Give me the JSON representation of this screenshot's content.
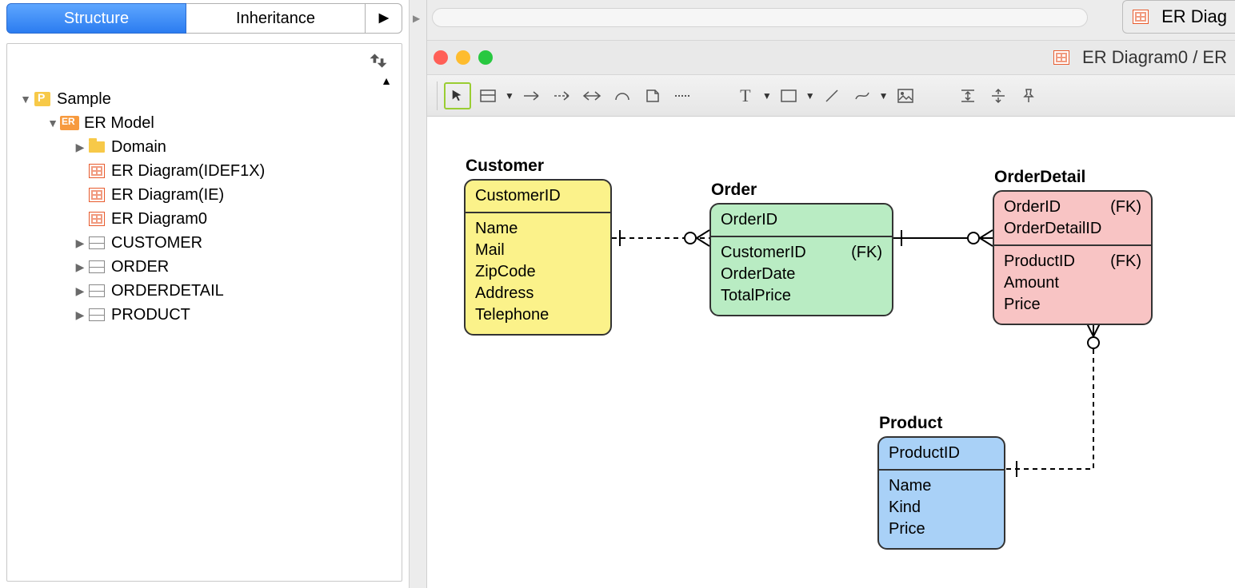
{
  "sidebar": {
    "tabs": {
      "structure": "Structure",
      "inheritance": "Inheritance"
    },
    "tree": {
      "root": "Sample",
      "ermodel": "ER Model",
      "domain": "Domain",
      "diag_idef1x": "ER Diagram(IDEF1X)",
      "diag_ie": "ER Diagram(IE)",
      "diag0": "ER Diagram0",
      "t_customer": "CUSTOMER",
      "t_order": "ORDER",
      "t_orderdetail": "ORDERDETAIL",
      "t_product": "PRODUCT"
    }
  },
  "docTab": "ER Diag",
  "winTitle": "ER Diagram0 / ER",
  "fk_label": "(FK)",
  "entities": {
    "customer": {
      "title": "Customer",
      "pk": [
        "CustomerID"
      ],
      "attrs": [
        "Name",
        "Mail",
        "ZipCode",
        "Address",
        "Telephone"
      ]
    },
    "order": {
      "title": "Order",
      "pk": [
        "OrderID"
      ],
      "attrs": [
        {
          "name": "CustomerID",
          "fk": true
        },
        {
          "name": "OrderDate"
        },
        {
          "name": "TotalPrice"
        }
      ]
    },
    "orderdetail": {
      "title": "OrderDetail",
      "pk": [
        {
          "name": "OrderID",
          "fk": true
        },
        {
          "name": "OrderDetailID"
        }
      ],
      "attrs": [
        {
          "name": "ProductID",
          "fk": true
        },
        {
          "name": "Amount"
        },
        {
          "name": "Price"
        }
      ]
    },
    "product": {
      "title": "Product",
      "pk": [
        "ProductID"
      ],
      "attrs": [
        "Name",
        "Kind",
        "Price"
      ]
    }
  }
}
